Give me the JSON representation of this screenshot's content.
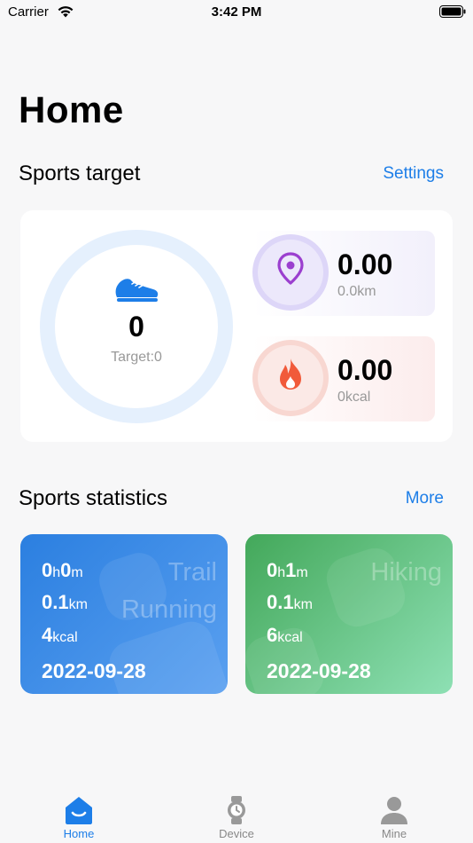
{
  "status_bar": {
    "carrier": "Carrier",
    "time": "3:42 PM"
  },
  "page": {
    "title": "Home"
  },
  "sports_target": {
    "title": "Sports target",
    "settings_label": "Settings",
    "steps": {
      "value": "0",
      "target_label": "Target:0"
    },
    "distance": {
      "value": "0.00",
      "sub": "0.0km"
    },
    "calories": {
      "value": "0.00",
      "sub": "0kcal"
    }
  },
  "sports_statistics": {
    "title": "Sports statistics",
    "more_label": "More",
    "cards": [
      {
        "watermark_line1": "Trail",
        "watermark_line2": "Running",
        "hours": "0",
        "hours_unit": "h",
        "minutes": "0",
        "minutes_unit": "m",
        "distance": "0.1",
        "distance_unit": "km",
        "calories": "4",
        "calories_unit": "kcal",
        "date": "2022-09-28"
      },
      {
        "watermark_line1": "Hiking",
        "watermark_line2": "",
        "hours": "0",
        "hours_unit": "h",
        "minutes": "1",
        "minutes_unit": "m",
        "distance": "0.1",
        "distance_unit": "km",
        "calories": "6",
        "calories_unit": "kcal",
        "date": "2022-09-28"
      }
    ]
  },
  "tab_bar": {
    "items": [
      {
        "label": "Home",
        "icon": "home-icon",
        "active": true
      },
      {
        "label": "Device",
        "icon": "watch-icon",
        "active": false
      },
      {
        "label": "Mine",
        "icon": "person-icon",
        "active": false
      }
    ]
  },
  "colors": {
    "accent": "#1d7ee8",
    "running_card": "#2b7fe0",
    "hiking_card": "#43a85a",
    "distance_icon": "#9b3fcf",
    "calorie_icon": "#f15a3a"
  }
}
